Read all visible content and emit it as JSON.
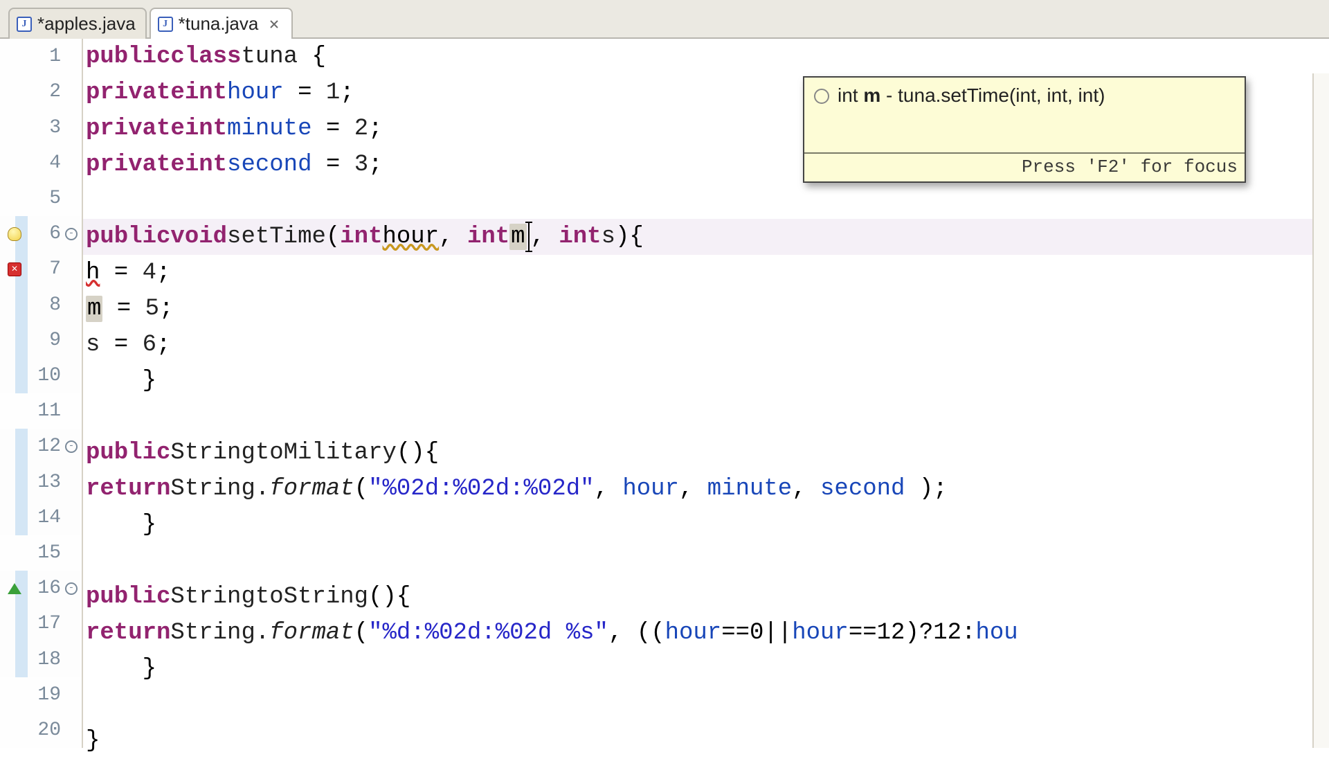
{
  "tabs": [
    {
      "label": "*apples.java",
      "icon": "java-file-icon",
      "active": false,
      "closable": false
    },
    {
      "label": "*tuna.java",
      "icon": "java-file-icon",
      "active": true,
      "closable": true
    }
  ],
  "gutter": {
    "line_numbers": [
      "1",
      "2",
      "3",
      "4",
      "5",
      "6",
      "7",
      "8",
      "9",
      "10",
      "11",
      "12",
      "13",
      "14",
      "15",
      "16",
      "17",
      "18",
      "19",
      "20"
    ]
  },
  "code": {
    "l1": {
      "kw1": "public",
      "kw2": "class",
      "name": "tuna",
      "b": " {"
    },
    "l2": {
      "kw1": "private",
      "kw2": "int",
      "name": "hour",
      "eq": " = ",
      "val": "1",
      "sc": ";"
    },
    "l3": {
      "kw1": "private",
      "kw2": "int",
      "name": "minute",
      "eq": " = ",
      "val": "2",
      "sc": ";"
    },
    "l4": {
      "kw1": "private",
      "kw2": "int",
      "name": "second",
      "eq": " = ",
      "val": "3",
      "sc": ";"
    },
    "l5": "",
    "l6": {
      "kw1": "public",
      "kw2": "void",
      "name": "setTime",
      "lp": "(",
      "p1k": "int",
      "p1n": "hour",
      "c1": ", ",
      "p2k": "int",
      "p2n": "m",
      "c2": ", ",
      "p3k": "int",
      "p3n": "s",
      "rp": ")",
      "b": "{"
    },
    "l7": {
      "id": "h",
      "eq": " = ",
      "val": "4",
      "sc": ";"
    },
    "l8": {
      "id": "m",
      "eq": " = ",
      "val": "5",
      "sc": ";"
    },
    "l9": {
      "id": "s",
      "eq": " = ",
      "val": "6",
      "sc": ";"
    },
    "l10": "    }",
    "l11": "",
    "l12": {
      "kw1": "public",
      "type": "String",
      "name": "toMilitary",
      "lp": "(",
      "rp": ")",
      "b": "{"
    },
    "l13": {
      "kw1": "return",
      "cls": "String.",
      "m": "format",
      "lp": "(",
      "str": "\"%02d:%02d:%02d\"",
      "c1": ", ",
      "a1": "hour",
      "c2": ", ",
      "a2": "minute",
      "c3": ", ",
      "a3": "second",
      "sp1": " ",
      "rp": ")",
      "sc": ";"
    },
    "l14": "    }",
    "l15": "",
    "l16": {
      "kw1": "public",
      "type": "String",
      "name": "toString",
      "lp": "(",
      "rp": ")",
      "b": "{"
    },
    "l17": {
      "kw1": "return",
      "cls": "String.",
      "m": "format",
      "lp": "(",
      "str": "\"%d:%02d:%02d %s\"",
      "c1": ", ",
      "expr": "((",
      "a1": "hour",
      "e1": "==0||",
      "a2": "hour",
      "e2": "==12)?12:",
      "a3": "hou"
    },
    "l18": "    }",
    "l19": "",
    "l20": "}"
  },
  "tooltip": {
    "text_prefix": "int ",
    "text_bold": "m",
    "text_suffix": " - tuna.setTime(int, int, int)",
    "footer": "Press 'F2' for focus"
  }
}
